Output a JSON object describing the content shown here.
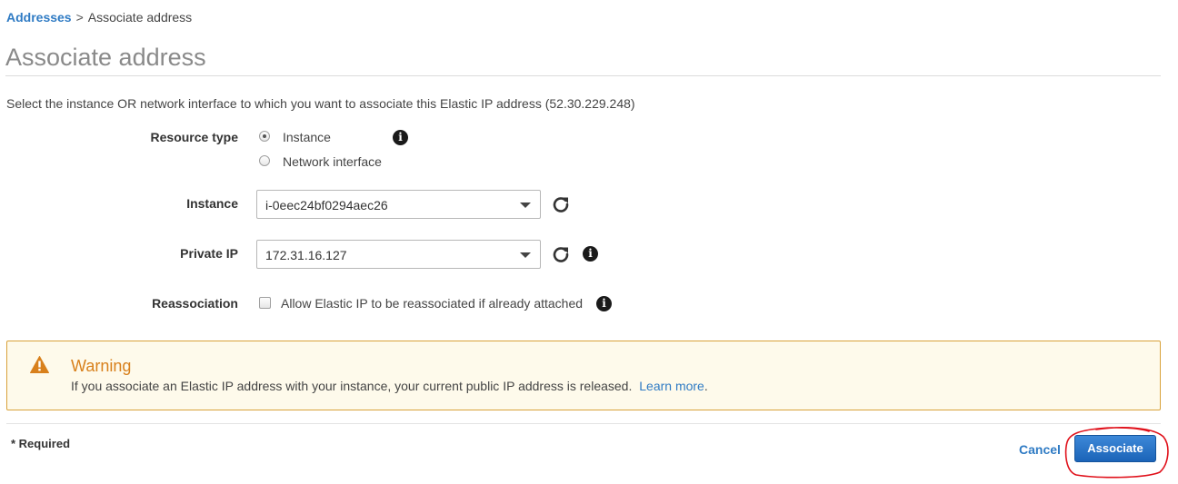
{
  "breadcrumb": {
    "parent_label": "Addresses",
    "separator": ">",
    "current_label": "Associate address"
  },
  "page": {
    "title": "Associate address",
    "description": "Select the instance OR network interface to which you want to associate this Elastic IP address (52.30.229.248)"
  },
  "form": {
    "resource_type": {
      "label": "Resource type",
      "options": [
        {
          "label": "Instance",
          "selected": true
        },
        {
          "label": "Network interface",
          "selected": false
        }
      ]
    },
    "instance": {
      "label": "Instance",
      "value": "i-0eec24bf0294aec26"
    },
    "private_ip": {
      "label": "Private IP",
      "value": "172.31.16.127"
    },
    "reassociation": {
      "label": "Reassociation",
      "checkbox_label": "Allow Elastic IP to be reassociated if already attached",
      "checked": false
    }
  },
  "warning": {
    "title": "Warning",
    "message": "If you associate an Elastic IP address with your instance, your current public IP address is released.",
    "link_label": "Learn more",
    "trailing": ".",
    "accent_color": "#d8801c"
  },
  "footer": {
    "required_note": "* Required",
    "cancel_label": "Cancel",
    "associate_label": "Associate"
  },
  "icons": {
    "info": "i",
    "warning": "warning-triangle-icon",
    "refresh": "refresh-icon"
  },
  "colors": {
    "link": "#2f7bc4",
    "primary_button": "#1b64b8"
  }
}
